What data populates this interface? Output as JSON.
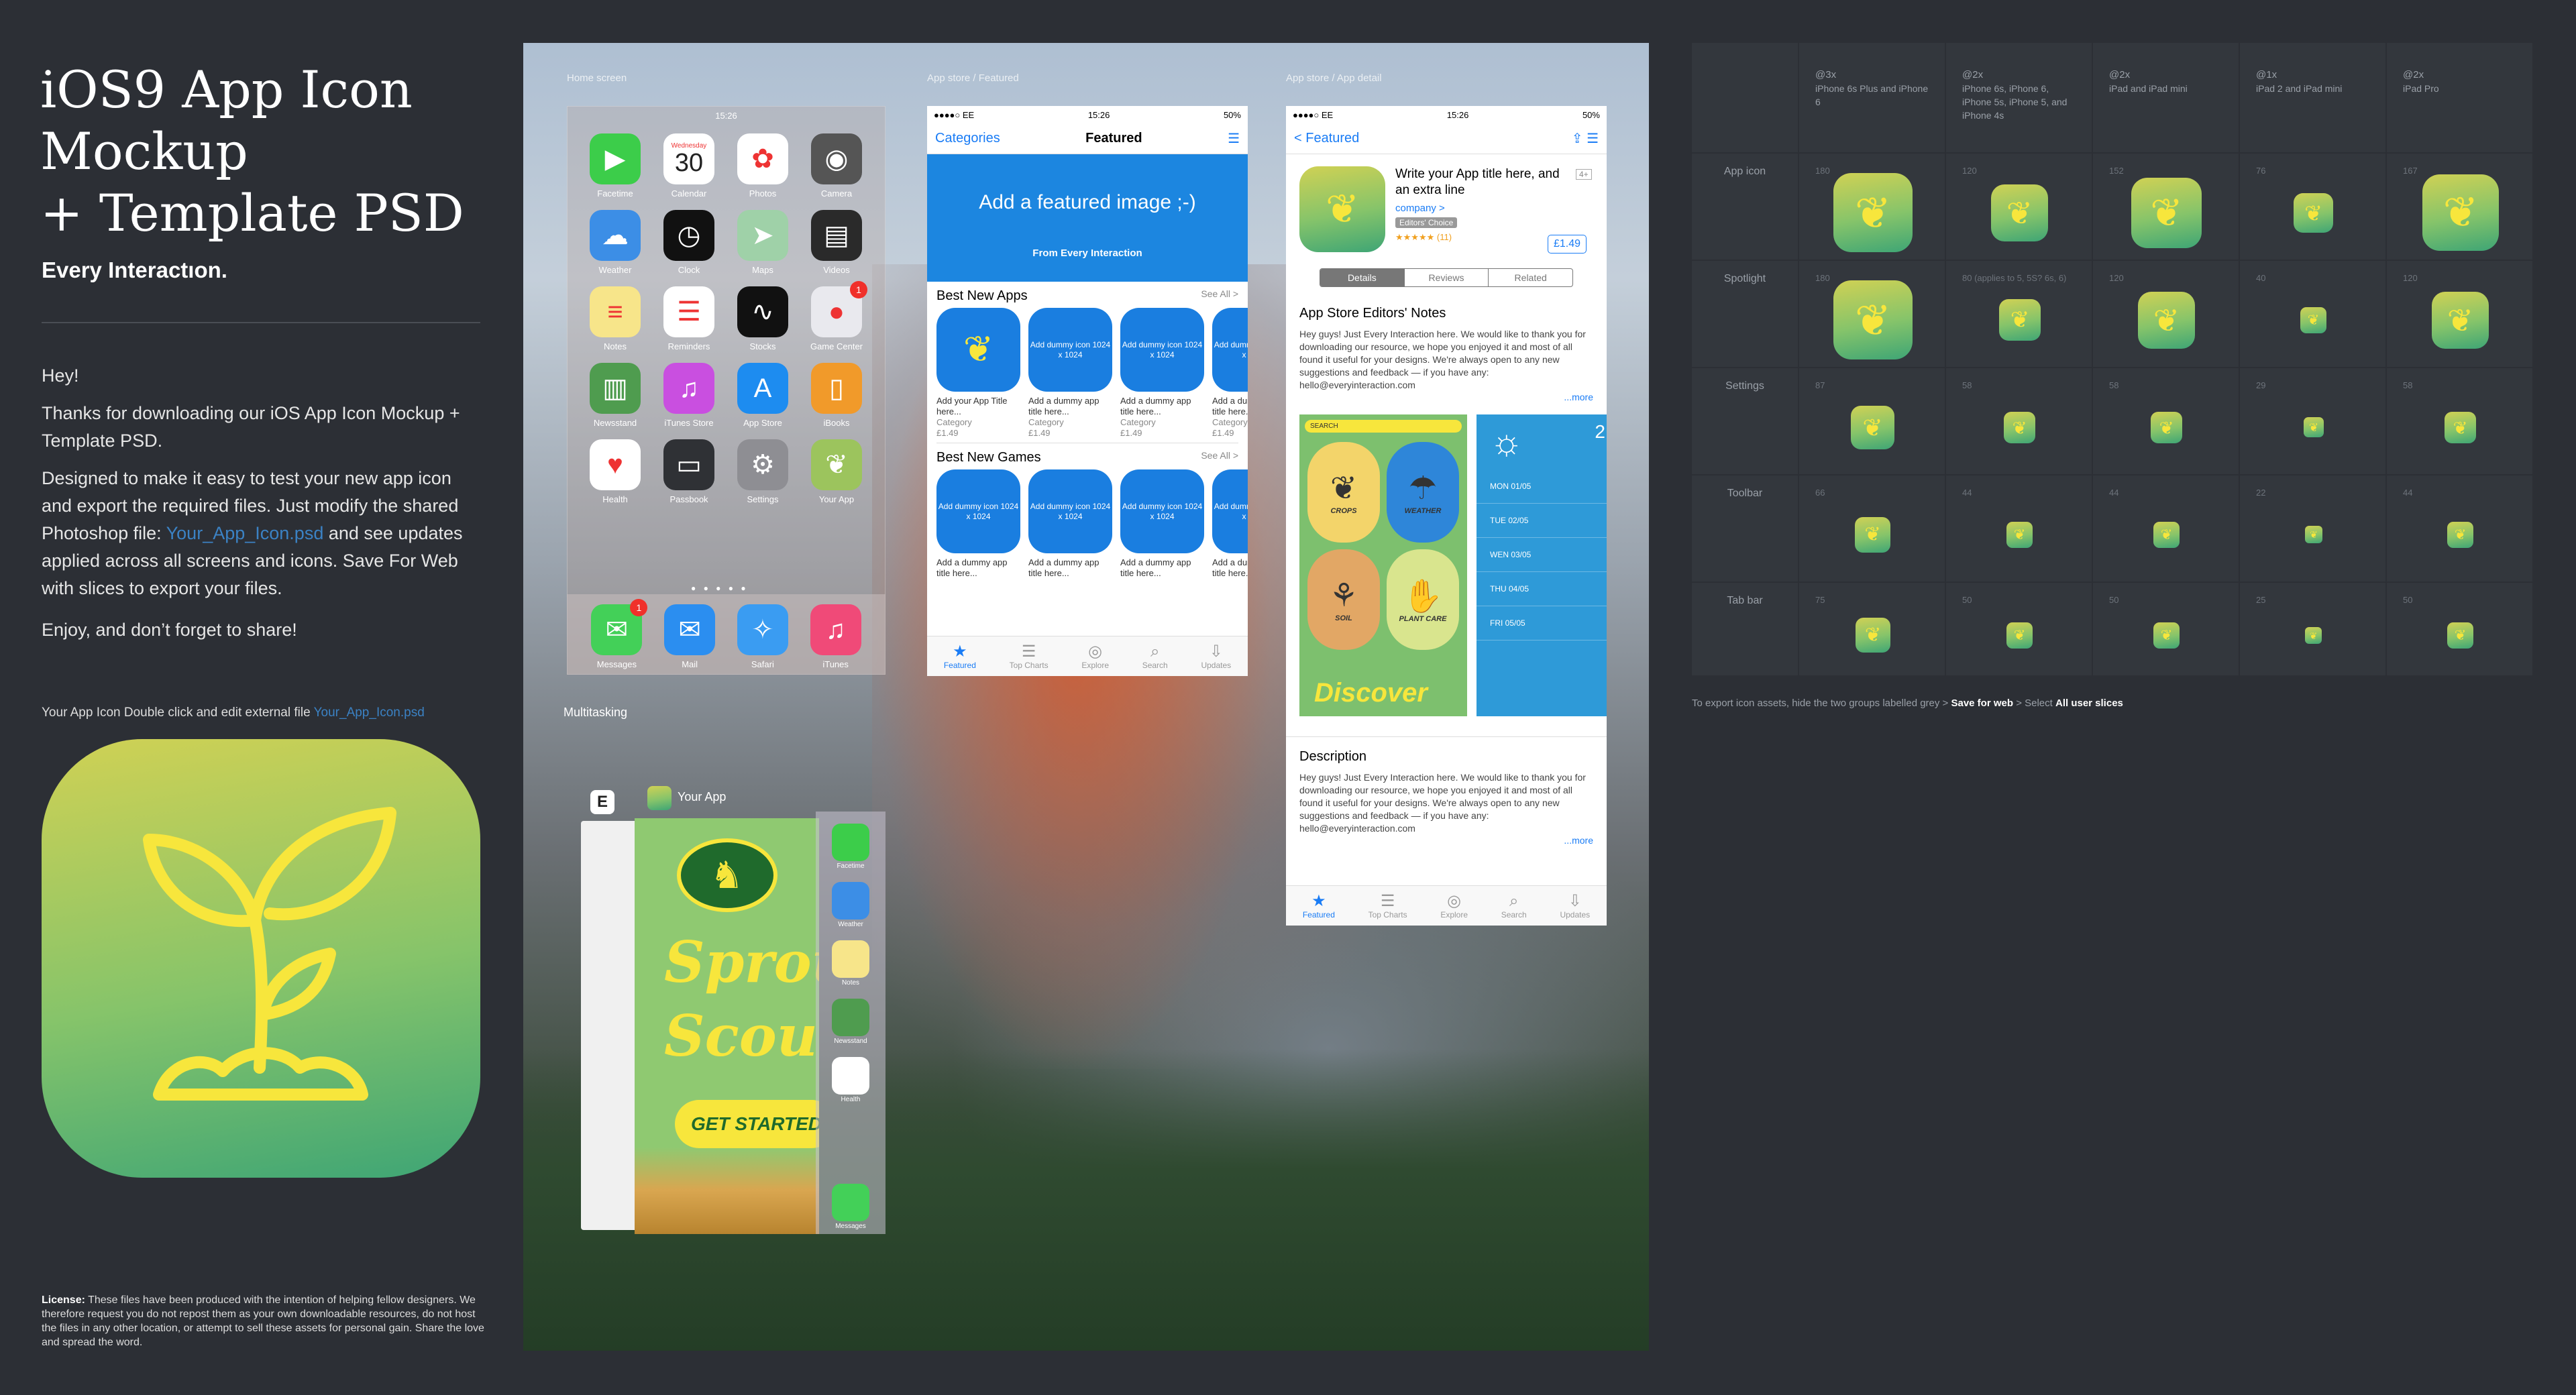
{
  "sidebar": {
    "title": "iOS9 App Icon\nMockup\n+ Template PSD",
    "tagline": "Every Interactıon.",
    "hey": "Hey!",
    "thanks": "Thanks for downloading our iOS App Icon Mockup + Template PSD.",
    "designed_pre": "Designed to make it easy to test your new app icon and export the required files. Just modify the shared Photoshop file: ",
    "designed_link": "Your_App_Icon.psd",
    "designed_post": " and see updates applied across all screens and icons. Save For Web with slices to export your files.",
    "enjoy": "Enjoy, and don’t forget to share!",
    "icon_caption": "Your App Icon Double click and edit external file ",
    "icon_caption_link": "Your_App_Icon.psd",
    "license_label": "License:",
    "license_text": " These files have been produced with the intention of helping fellow designers. We therefore request you do not repost them as your own downloadable resources, do not host the files in any other location, or attempt to sell these assets for personal gain. Share the love and spread the word."
  },
  "screens": {
    "home_label": "Home screen",
    "featured_label": "App store / Featured",
    "detail_label": "App store / App detail",
    "multitask_label": "Multitasking",
    "time": "15:26",
    "battery": "50%",
    "carrier": "●●●●○ EE"
  },
  "home": {
    "calendar_day": "Wednesday",
    "calendar_date": "30",
    "apps": [
      {
        "name": "Facetime",
        "color": "#3ccd4a",
        "glyph": "▶"
      },
      {
        "name": "Calendar",
        "color": "#ffffff",
        "glyph": ""
      },
      {
        "name": "Photos",
        "color": "#ffffff",
        "glyph": "✿"
      },
      {
        "name": "Camera",
        "color": "#555555",
        "glyph": "◉"
      },
      {
        "name": "Weather",
        "color": "#3c8ee6",
        "glyph": "☁"
      },
      {
        "name": "Clock",
        "color": "#111111",
        "glyph": "◷"
      },
      {
        "name": "Maps",
        "color": "#9fd1a8",
        "glyph": "➤"
      },
      {
        "name": "Videos",
        "color": "#2a2a2a",
        "glyph": "▤"
      },
      {
        "name": "Notes",
        "color": "#f7e58a",
        "glyph": "≡"
      },
      {
        "name": "Reminders",
        "color": "#ffffff",
        "glyph": "☰"
      },
      {
        "name": "Stocks",
        "color": "#111111",
        "glyph": "∿"
      },
      {
        "name": "Game Center",
        "color": "#e9e9ee",
        "glyph": "●"
      },
      {
        "name": "Newsstand",
        "color": "#4f9c4f",
        "glyph": "▥"
      },
      {
        "name": "iTunes Store",
        "color": "#c94fe0",
        "glyph": "♫"
      },
      {
        "name": "App Store",
        "color": "#1d8cf0",
        "glyph": "A"
      },
      {
        "name": "iBooks",
        "color": "#f19a2a",
        "glyph": "▯"
      },
      {
        "name": "Health",
        "color": "#ffffff",
        "glyph": "♥"
      },
      {
        "name": "Passbook",
        "color": "#2f3135",
        "glyph": "▭"
      },
      {
        "name": "Settings",
        "color": "#8e8e93",
        "glyph": "⚙"
      },
      {
        "name": "Your App",
        "color": "#9cc45d",
        "glyph": "❦"
      }
    ],
    "gamecenter_badge": "1",
    "dock": [
      {
        "name": "Messages",
        "color": "#43d058",
        "glyph": "✉",
        "badge": "1"
      },
      {
        "name": "Mail",
        "color": "#2b8ef0",
        "glyph": "✉",
        "badge": ""
      },
      {
        "name": "Safari",
        "color": "#3a9cf2",
        "glyph": "✧",
        "badge": ""
      },
      {
        "name": "iTunes",
        "color": "#f04a78",
        "glyph": "♫",
        "badge": ""
      }
    ]
  },
  "featured": {
    "left": "Categories",
    "title": "Featured",
    "banner": "Add a featured image ;-)",
    "banner_sub": "From Every Interaction",
    "new_apps": "Best New Apps",
    "new_games": "Best New Games",
    "see_all": "See All >",
    "first_tile": "Add your App Title here...",
    "category": "Category",
    "price": "£1.49",
    "dummy": "Add dummy icon 1024 x 1024",
    "dummy_title": "Add a dummy app title here..."
  },
  "tabs": [
    "Featured",
    "Top Charts",
    "Explore",
    "Search",
    "Updates"
  ],
  "detail": {
    "back": "< Featured",
    "app_title": "Write your App title here, and an extra line",
    "company": "company >",
    "badge": "Editors' Choice",
    "rating": "★★★★★ (11)",
    "age": "4+",
    "price": "£1.49",
    "seg": [
      "Details",
      "Reviews",
      "Related"
    ],
    "notes_title": "App Store Editors' Notes",
    "notes_text": "Hey guys! Just Every Interaction here. We would like to thank you for downloading our resource, we hope you enjoyed it and most of all found it useful for your designs. We're always open to any new suggestions and feedback — if you have any: hello@everyinteraction.com",
    "more": "...more",
    "desc_title": "Description",
    "desc_text": "Hey guys! Just Every Interaction here. We would like to thank you for downloading our resource, we hope you enjoyed it and most of all found it useful for your designs. We're always open to any new suggestions and feedback — if you have any: hello@everyinteraction.com",
    "shot1_search": "SEARCH",
    "shot1_items": [
      "CROPS",
      "WEATHER",
      "SOIL",
      "PLANT CARE"
    ],
    "shot1_cta": "Discover",
    "shot2_date": "2",
    "shot2_days": [
      "MON 01/05",
      "TUE 02/05",
      "WEN 03/05",
      "THU 04/05",
      "FRI 05/05"
    ]
  },
  "multitask": {
    "app_name": "Your App",
    "big_text_1": "Sprou",
    "big_text_2": "Scout",
    "cta": "GET STARTED",
    "side": [
      {
        "name": "Facetime",
        "color": "#3ccd4a"
      },
      {
        "name": "Weather",
        "color": "#3c8ee6"
      },
      {
        "name": "Notes",
        "color": "#f7e58a"
      },
      {
        "name": "Newsstand",
        "color": "#4f9c4f"
      },
      {
        "name": "Health",
        "color": "#ffffff"
      },
      {
        "name": "Messages",
        "color": "#43d058"
      }
    ]
  },
  "table": {
    "headers": [
      {
        "scale": "@3x",
        "devices": "iPhone 6s Plus and iPhone 6"
      },
      {
        "scale": "@2x",
        "devices": "iPhone 6s, iPhone 6, iPhone 5s, iPhone 5, and iPhone 4s"
      },
      {
        "scale": "@2x",
        "devices": "iPad and iPad mini"
      },
      {
        "scale": "@1x",
        "devices": "iPad 2 and iPad mini"
      },
      {
        "scale": "@2x",
        "devices": "iPad Pro"
      }
    ],
    "rows": [
      {
        "label": "App icon",
        "sizes": [
          "180",
          "120",
          "152",
          "76",
          "167"
        ],
        "fractions": [
          0.75,
          0.52,
          0.66,
          0.34,
          0.72
        ]
      },
      {
        "label": "Spotlight",
        "sizes": [
          "180",
          "80 (applies to 5, 5S? 6s, 6)",
          "120",
          "40",
          "120"
        ],
        "fractions": [
          0.75,
          0.36,
          0.52,
          0.2,
          0.52
        ]
      },
      {
        "label": "Settings",
        "sizes": [
          "87",
          "58",
          "58",
          "29",
          "58"
        ],
        "fractions": [
          0.38,
          0.26,
          0.26,
          0.14,
          0.26
        ]
      },
      {
        "label": "Toolbar",
        "sizes": [
          "66",
          "44",
          "44",
          "22",
          "44"
        ],
        "fractions": [
          0.3,
          0.2,
          0.2,
          0.11,
          0.2
        ]
      },
      {
        "label": "Tab bar",
        "sizes": [
          "75",
          "50",
          "50",
          "25",
          "50"
        ],
        "fractions": [
          0.33,
          0.23,
          0.23,
          0.12,
          0.23
        ]
      }
    ],
    "footnote_pre": "To export icon assets, hide the two groups labelled grey > ",
    "footnote_b1": "Save for web",
    "footnote_mid": " > Select ",
    "footnote_b2": "All user slices"
  },
  "colors": {
    "accent": "#1a7cf5",
    "icon_top": "#d0d154",
    "icon_bottom": "#3ea575",
    "sprout": "#f7e63c",
    "bg": "#2c2f35"
  }
}
